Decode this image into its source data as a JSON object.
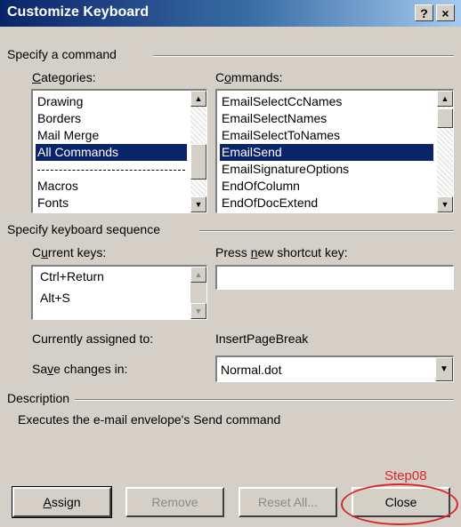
{
  "window": {
    "title": "Customize Keyboard",
    "help_button": "?",
    "close_button": "×"
  },
  "specify_command": {
    "group_label": "Specify a command",
    "categories": {
      "label_pre": "",
      "label_ul": "C",
      "label_post": "ategories:",
      "items": [
        "Drawing",
        "Borders",
        "Mail Merge",
        "All Commands",
        "",
        "Macros",
        "Fonts"
      ],
      "selected": "All Commands"
    },
    "commands": {
      "label_pre": "C",
      "label_ul": "o",
      "label_post": "mmands:",
      "items": [
        "EmailSelectCcNames",
        "EmailSelectNames",
        "EmailSelectToNames",
        "EmailSend",
        "EmailSignatureOptions",
        "EndOfColumn",
        "EndOfDocExtend"
      ],
      "selected": "EmailSend"
    }
  },
  "keyboard_sequence": {
    "group_label": "Specify keyboard sequence",
    "current_keys": {
      "label_pre": "C",
      "label_ul": "u",
      "label_post": "rrent keys:",
      "items": [
        "Ctrl+Return",
        "Alt+S"
      ]
    },
    "new_shortcut": {
      "label_pre": "Press ",
      "label_ul": "n",
      "label_post": "ew shortcut key:",
      "value": ""
    }
  },
  "assigned": {
    "label": "Currently assigned to:",
    "value": "InsertPageBreak"
  },
  "save_in": {
    "label_pre": "Sa",
    "label_ul": "v",
    "label_post": "e changes in:",
    "value": "Normal.dot"
  },
  "description": {
    "group_label": "Description",
    "text": "Executes the e-mail envelope's Send command"
  },
  "buttons": {
    "assign_ul": "A",
    "assign_post": "ssign",
    "remove": "Remove",
    "reset_all": "Reset All...",
    "close": "Close"
  },
  "annotation": {
    "step_label": "Step08",
    "color": "#d9262c"
  },
  "colors": {
    "selection": "#0a246a",
    "dialog_bg": "#d4d0c8"
  }
}
